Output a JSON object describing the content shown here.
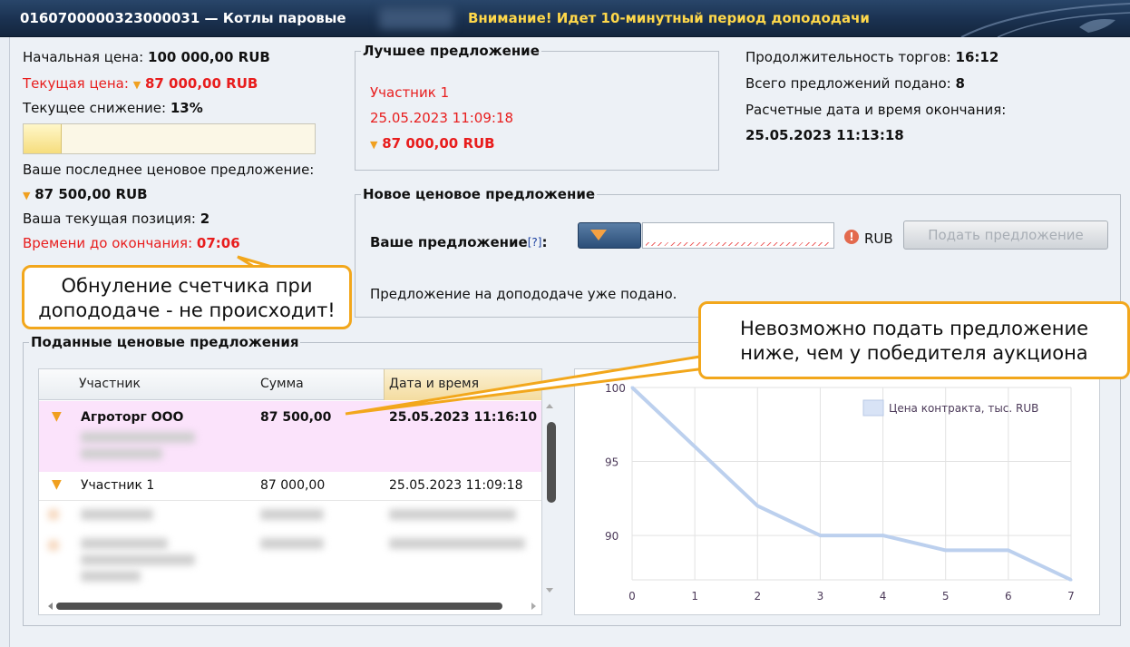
{
  "header": {
    "lot_title": "0160700000323000031 — Котлы паровые",
    "warning": "Внимание! Идет 10-минутный период допододачи"
  },
  "left_info": {
    "start_price_label": "Начальная цена: ",
    "start_price_value": "100 000,00 RUB",
    "current_price_label": "Текущая цена: ",
    "current_price_value": "87 000,00 RUB",
    "current_reduction_label": "Текущее снижение: ",
    "current_reduction_value": "13%",
    "reduction_fraction": 0.13,
    "last_offer_label": "Ваше последнее ценовое предложение:",
    "last_offer_value": "87 500,00 RUB",
    "position_label": "Ваша текущая позиция: ",
    "position_value": "2",
    "time_left_label": "Времени до окончания: ",
    "time_left_value": "07:06"
  },
  "best_offer": {
    "legend": "Лучшее предложение",
    "participant": "Участник 1",
    "datetime": "25.05.2023 11:09:18",
    "amount": "87 000,00 RUB"
  },
  "stats": {
    "duration_label": "Продолжительность торгов: ",
    "duration_value": "16:12",
    "total_offers_label": "Всего предложений подано: ",
    "total_offers_value": "8",
    "end_label": "Расчетные дата и время окончания:",
    "end_value": "25.05.2023 11:13:18"
  },
  "new_offer": {
    "legend": "Новое ценовое предложение",
    "your_offer_label": "Ваше предложение",
    "help": "[?]",
    "colon": ":",
    "input_value": "",
    "currency": "RUB",
    "submit_label": "Подать предложение",
    "notice": "Предложение на допододаче уже подано."
  },
  "callouts": {
    "left_line1": "Обнуление счетчика при",
    "left_line2": "допододаче - не происходит!",
    "right_line1": "Невозможно подать предложение",
    "right_line2": "ниже, чем у победителя аукциона"
  },
  "offers_table": {
    "legend": "Поданные ценовые предложения",
    "columns": [
      "Участник",
      "Сумма",
      "Дата и время"
    ],
    "rows": [
      {
        "participant": "Агроторг ООО",
        "amount": "87 500,00",
        "datetime": "25.05.2023 11:16:10"
      },
      {
        "participant": "Участник 1",
        "amount": "87 000,00",
        "datetime": "25.05.2023 11:09:18"
      }
    ]
  },
  "chart_data": {
    "type": "line",
    "x": [
      0,
      1,
      2,
      3,
      4,
      5,
      6,
      7
    ],
    "series": [
      {
        "name": "Цена контракта, тыс. RUB",
        "values": [
          100,
          96,
          92,
          90,
          90,
          89,
          89,
          87
        ]
      }
    ],
    "yticks": [
      90,
      95,
      100
    ],
    "xticks": [
      0,
      1,
      2,
      3,
      4,
      5,
      6,
      7
    ],
    "ylim": [
      87,
      100
    ],
    "xlim": [
      0,
      7
    ],
    "grid": true,
    "legend_position": "top-right",
    "line_color": "#bcd0ee"
  }
}
